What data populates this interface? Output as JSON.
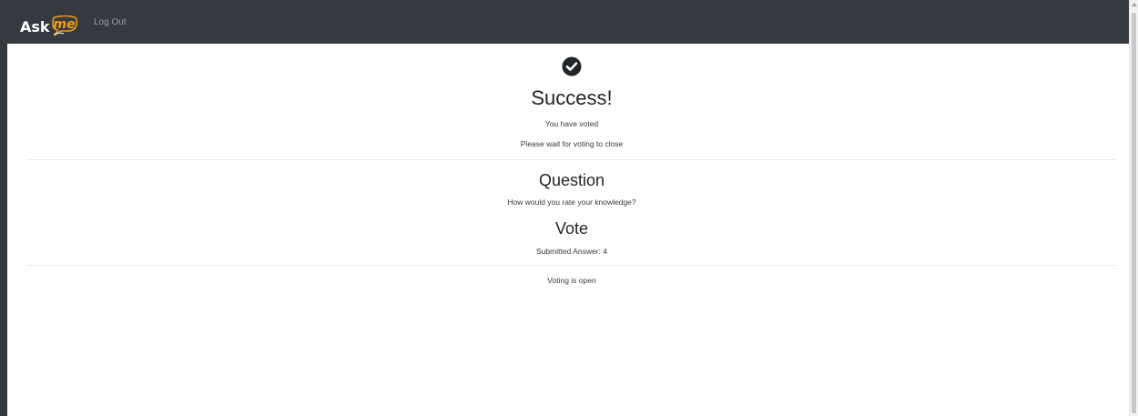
{
  "navbar": {
    "brand_text": "Ask",
    "brand_badge": "me",
    "logout_label": "Log Out"
  },
  "status": {
    "icon": "check-circle-icon",
    "title": "Success!",
    "line1": "You have voted",
    "line2": "Please wait for voting to close"
  },
  "question": {
    "heading": "Question",
    "text": "How would you rate your knowledge?"
  },
  "vote": {
    "heading": "Vote",
    "submitted": "Submitted Answer: 4"
  },
  "footer_status": "Voting is open",
  "colors": {
    "navbar_bg": "#343a40",
    "brand_accent": "#f39c12",
    "text": "#212529"
  }
}
